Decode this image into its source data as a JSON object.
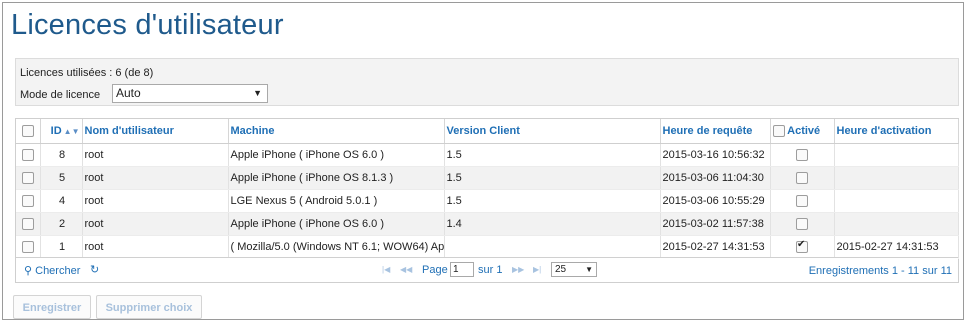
{
  "page": {
    "title": "Licences d'utilisateur"
  },
  "info": {
    "licenses_used": "Licences utilisées : 6 (de 8)",
    "mode_label": "Mode de licence",
    "mode_value": "Auto"
  },
  "table": {
    "columns": {
      "id": "ID",
      "user": "Nom d'utilisateur",
      "machine": "Machine",
      "client_version": "Version Client",
      "request_time": "Heure de requête",
      "active": "Activé",
      "activation_time": "Heure d'activation"
    },
    "rows": [
      {
        "id": "8",
        "user": "root",
        "machine": "Apple iPhone ( iPhone OS 6.0 )",
        "client_version": "1.5",
        "request_time": "2015-03-16 10:56:32",
        "active": false,
        "activation_time": ""
      },
      {
        "id": "5",
        "user": "root",
        "machine": "Apple iPhone ( iPhone OS 8.1.3 )",
        "client_version": "1.5",
        "request_time": "2015-03-06 11:04:30",
        "active": false,
        "activation_time": ""
      },
      {
        "id": "4",
        "user": "root",
        "machine": "LGE Nexus 5 ( Android 5.0.1 )",
        "client_version": "1.5",
        "request_time": "2015-03-06 10:55:29",
        "active": false,
        "activation_time": ""
      },
      {
        "id": "2",
        "user": "root",
        "machine": "Apple iPhone ( iPhone OS 6.0 )",
        "client_version": "1.4",
        "request_time": "2015-03-02 11:57:38",
        "active": false,
        "activation_time": ""
      },
      {
        "id": "1",
        "user": "root",
        "machine": " ( Mozilla/5.0 (Windows NT 6.1; WOW64) Ap",
        "client_version": "",
        "request_time": "2015-02-27 14:31:53",
        "active": true,
        "activation_time": "2015-02-27 14:31:53"
      }
    ]
  },
  "pager": {
    "search_label": "Chercher",
    "page_label": "Page",
    "page_value": "1",
    "of_label": "sur 1",
    "rows_per_page": "25",
    "records_label": "Enregistrements 1 - 11 sur 11"
  },
  "buttons": {
    "save": "Enregistrer",
    "delete": "Supprimer choix"
  },
  "icons": {
    "search": "search-icon",
    "refresh": "refresh-icon",
    "first": "first-page-icon",
    "prev": "prev-page-icon",
    "next": "next-page-icon",
    "last": "last-page-icon",
    "sort": "sort-icon",
    "dropdown": "chevron-down-icon"
  },
  "colors": {
    "title": "#1f5a8c",
    "link": "#1f6fb5",
    "row_alt": "#f2f2f2",
    "disabled_button_text": "#a8c1dc"
  }
}
